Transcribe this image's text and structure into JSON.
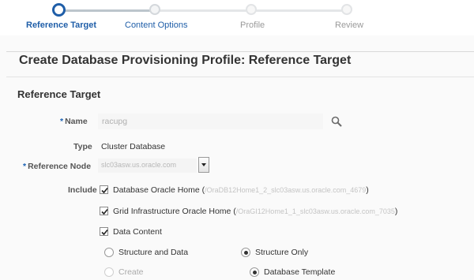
{
  "train": {
    "steps": [
      {
        "label": "Reference Target",
        "state": "current"
      },
      {
        "label": "Content Options",
        "state": "next"
      },
      {
        "label": "Profile",
        "state": "disabled"
      },
      {
        "label": "Review",
        "state": "disabled"
      }
    ]
  },
  "page": {
    "title": "Create Database Provisioning Profile: Reference Target",
    "section_title": "Reference Target"
  },
  "form": {
    "name_label": "Name",
    "name_value": "racupg",
    "type_label": "Type",
    "type_value": "Cluster Database",
    "ref_node_label": "Reference Node",
    "ref_node_value": "slc03asw.us.oracle.com",
    "include_label": "Include",
    "include": [
      {
        "label": "Database Oracle Home (",
        "detail": "/OraDB12Home1_2_slc03asw.us.oracle.com_4679",
        "suffix": ")",
        "checked": true
      },
      {
        "label": "Grid Infrastructure Oracle Home (",
        "detail": "/OraGI12Home1_1_slc03asw.us.oracle.com_7035",
        "suffix": ")",
        "checked": true
      },
      {
        "label": "Data Content",
        "checked": true
      }
    ],
    "content_options": [
      {
        "label": "Structure and Data",
        "selected": false,
        "enabled": true
      },
      {
        "label": "Structure Only",
        "selected": true,
        "enabled": true
      }
    ],
    "structure_options": [
      {
        "label": "Create",
        "selected": false,
        "enabled": false
      },
      {
        "label": "Database Template",
        "selected": true,
        "enabled": true
      }
    ]
  },
  "colors": {
    "accent": "#1f5ea8",
    "required_marker": "#1a61b3"
  }
}
